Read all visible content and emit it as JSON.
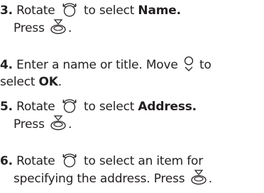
{
  "steps": [
    {
      "number": "3.",
      "line1": {
        "text_a": "Rotate",
        "text_b": "to select",
        "emph": "Name."
      },
      "line2": {
        "text_a": "Press",
        "text_b": "."
      }
    },
    {
      "number": "4.",
      "line1": {
        "text_a": "Enter a name or title. Move",
        "text_b": "to"
      },
      "line2": {
        "text_a": "select",
        "emph": "OK",
        "text_b": "."
      }
    },
    {
      "number": "5.",
      "line1": {
        "text_a": "Rotate",
        "text_b": "to select",
        "emph": "Address."
      },
      "line2": {
        "text_a": "Press",
        "text_b": "."
      }
    },
    {
      "number": "6.",
      "line1": {
        "text_a": "Rotate",
        "text_b": "to select an item for"
      },
      "line2": {
        "text_a": "specifying the address. Press",
        "text_b": "."
      }
    }
  ],
  "icons": {
    "rotate": "interface-dial-rotate-icon",
    "press": "interface-dial-press-icon",
    "move_down": "interface-dial-move-down-icon"
  },
  "colors": {
    "text": "#231f20"
  }
}
